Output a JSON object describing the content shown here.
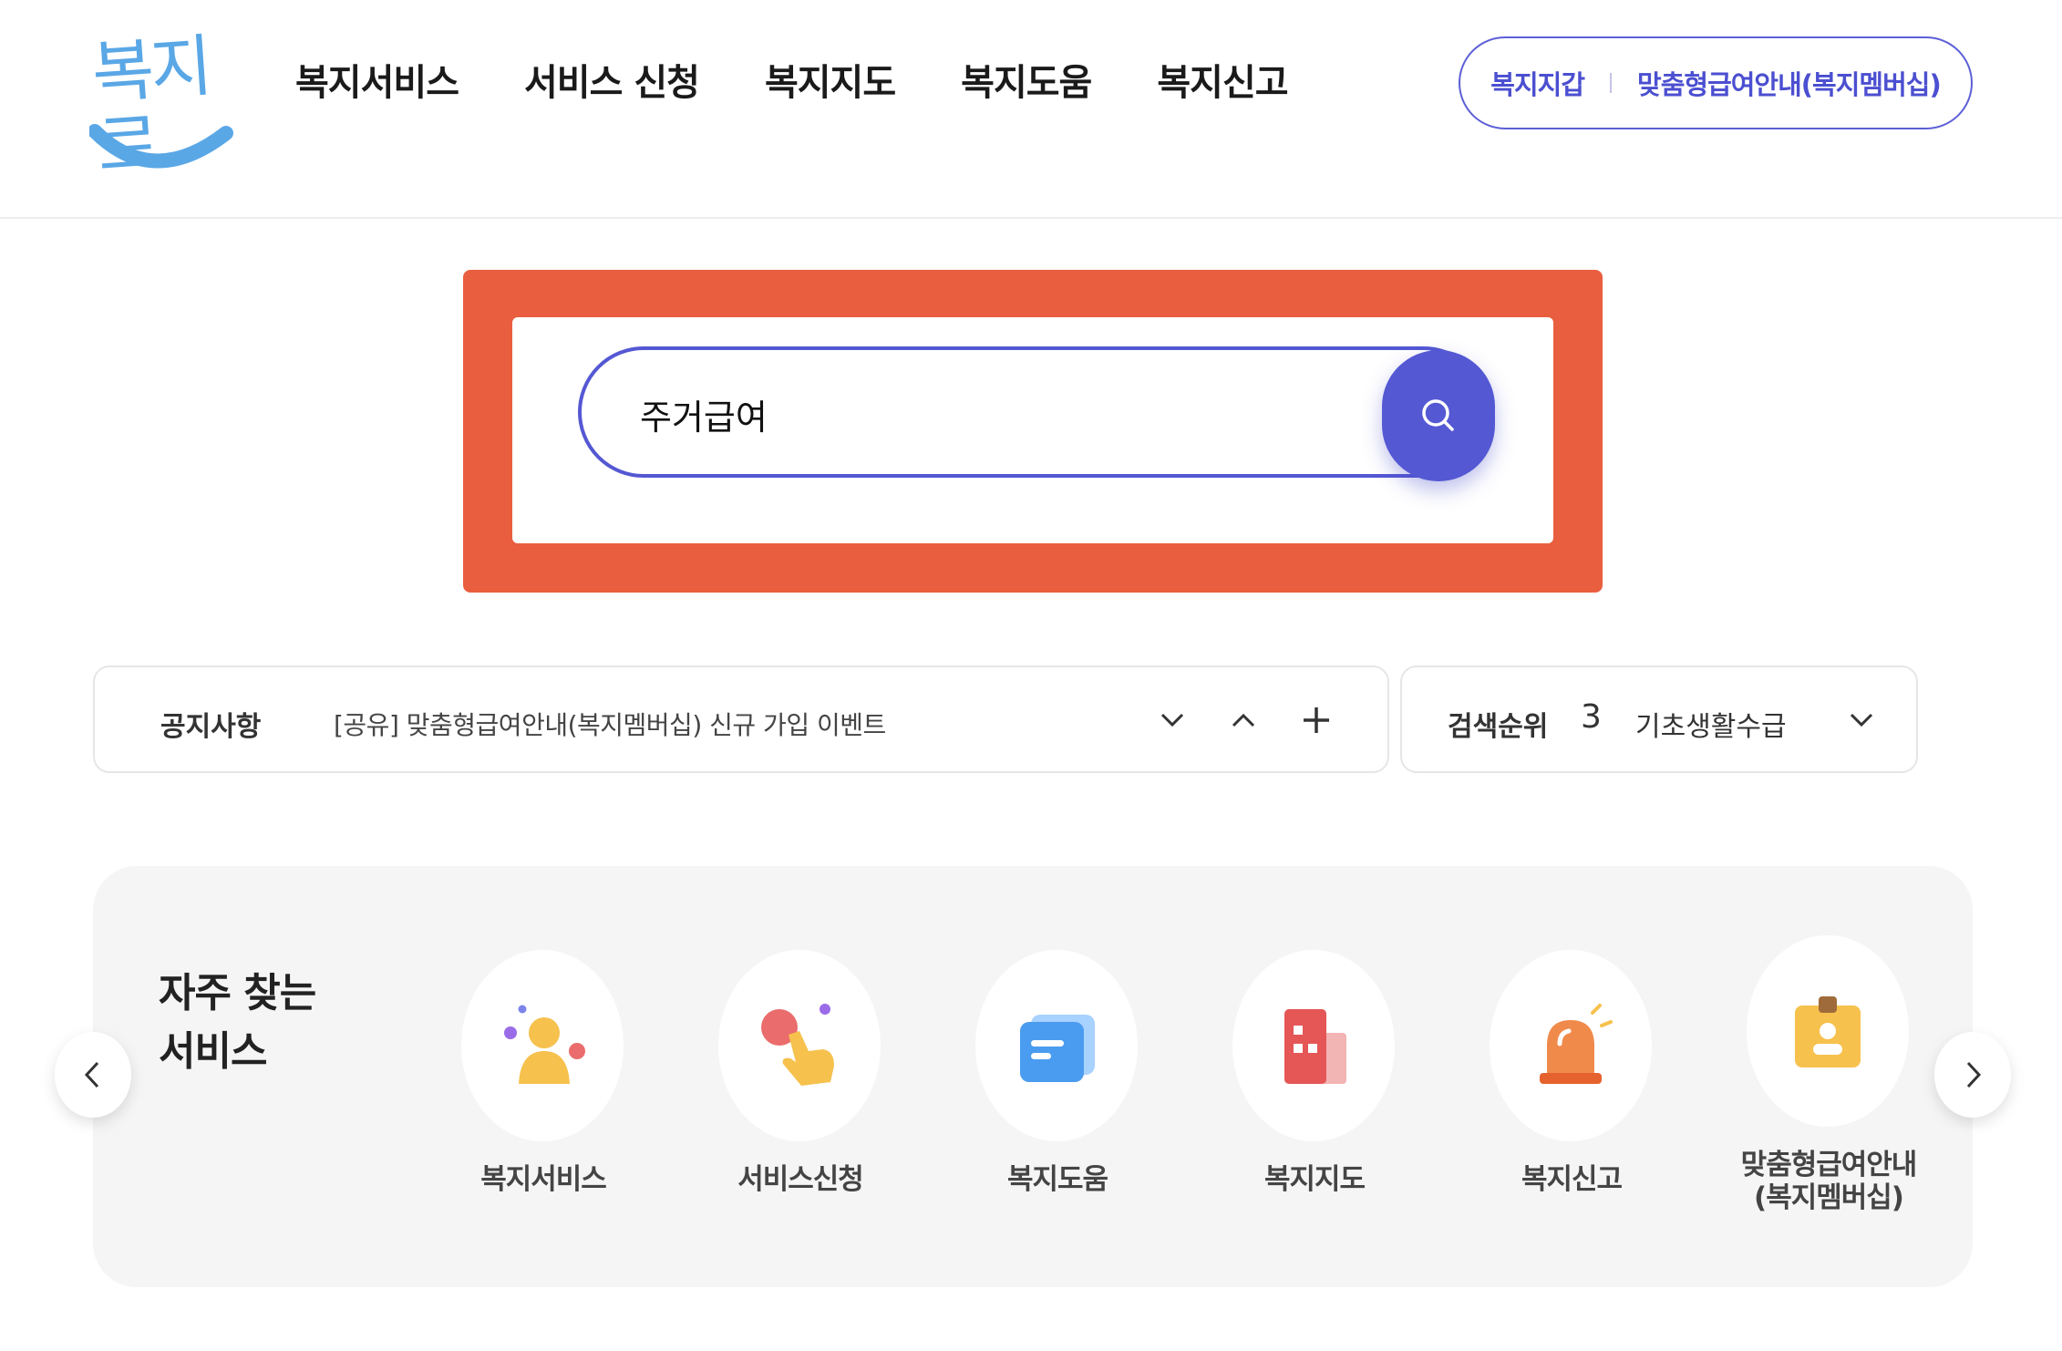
{
  "header": {
    "logo_text": "복지로",
    "nav": [
      "복지서비스",
      "서비스 신청",
      "복지지도",
      "복지도움",
      "복지신고"
    ],
    "util": [
      "복지지갑",
      "맞춤형급여안내(복지멤버십)"
    ]
  },
  "search": {
    "value": "주거급여",
    "button_icon": "search-icon"
  },
  "notice": {
    "label": "공지사항",
    "text": "[공유] 맞춤형급여안내(복지멤버십) 신규 가입 이벤트",
    "controls": [
      "chevron-down-icon",
      "chevron-up-icon",
      "plus-icon"
    ]
  },
  "rank": {
    "label": "검색순위",
    "number": "3",
    "text": "기초생활수급"
  },
  "services": {
    "title": "자주 찾는 서비스",
    "items": [
      {
        "label": "복지서비스",
        "icon": "person-icon"
      },
      {
        "label": "서비스신청",
        "icon": "tap-hand-icon"
      },
      {
        "label": "복지도움",
        "icon": "chat-icon"
      },
      {
        "label": "복지지도",
        "icon": "building-icon"
      },
      {
        "label": "복지신고",
        "icon": "siren-icon"
      },
      {
        "label": "맞춤형급여안내\n(복지멤버십)",
        "icon": "id-card-icon"
      }
    ]
  },
  "colors": {
    "accent": "#5458d3",
    "highlight": "#e95e3e",
    "logo": "#5aa7e6"
  }
}
